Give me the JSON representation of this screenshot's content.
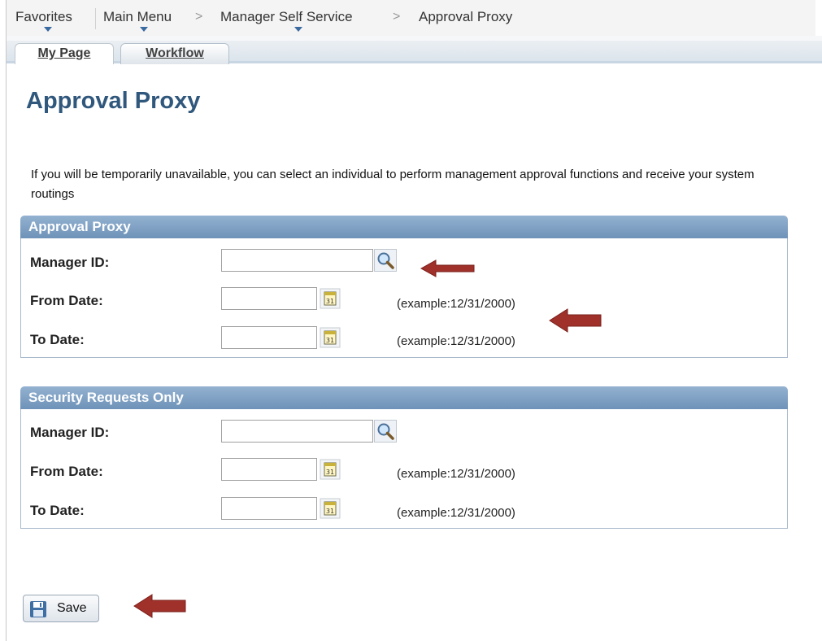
{
  "breadcrumb": {
    "favorites": "Favorites",
    "main_menu": "Main Menu",
    "manager_self_service": "Manager Self Service",
    "current": "Approval Proxy",
    "separator": ">"
  },
  "tabs": [
    {
      "label": "My Page",
      "active": true
    },
    {
      "label": "Workflow",
      "active": false
    }
  ],
  "page": {
    "title": "Approval Proxy",
    "instructions": "If you will be temporarily unavailable, you can select an individual to perform management approval functions and receive your system routings"
  },
  "approval_proxy": {
    "header": "Approval Proxy",
    "manager_id_label": "Manager ID:",
    "manager_id_value": "",
    "from_date_label": "From Date:",
    "from_date_value": "",
    "from_date_example": "(example:12/31/2000)",
    "to_date_label": "To Date:",
    "to_date_value": "",
    "to_date_example": "(example:12/31/2000)"
  },
  "security_requests": {
    "header": "Security Requests Only",
    "manager_id_label": "Manager ID:",
    "manager_id_value": "",
    "from_date_label": "From Date:",
    "from_date_value": "",
    "from_date_example": "(example:12/31/2000)",
    "to_date_label": "To Date:",
    "to_date_value": "",
    "to_date_example": "(example:12/31/2000)"
  },
  "save_button": {
    "label": "Save"
  },
  "icons": {
    "lookup": "magnifier-icon",
    "calendar": "calendar-icon",
    "save": "floppy-disk-icon",
    "annotation": "red-arrow-icon"
  },
  "colors": {
    "title": "#30577c",
    "group_header": "#7b9dc2",
    "annotation_arrow": "#a0302a"
  }
}
